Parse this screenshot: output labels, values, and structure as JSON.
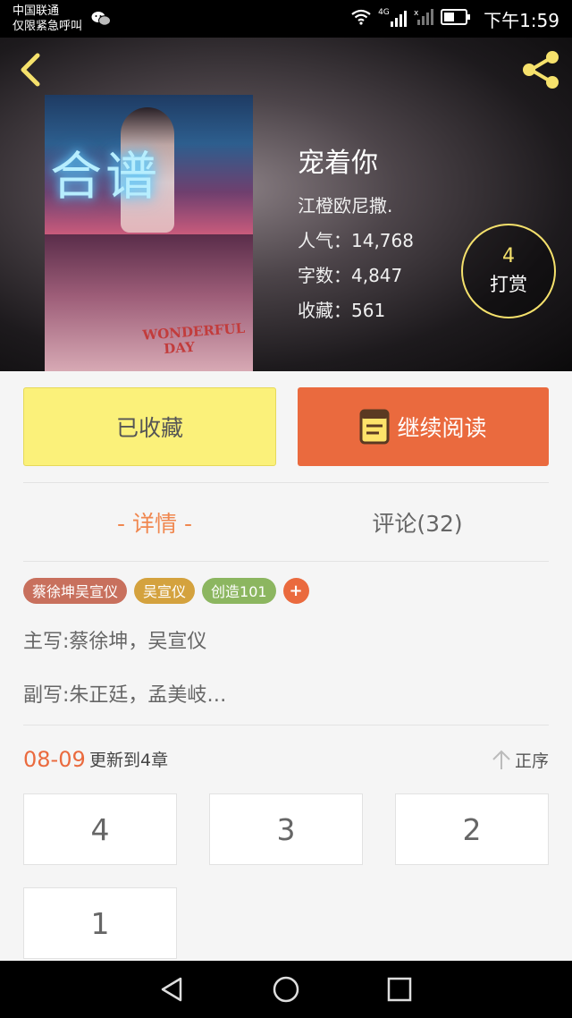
{
  "status_bar": {
    "carrier_line1": "中国联通",
    "carrier_line2": "仅限紧急呼叫",
    "network": "4G",
    "time": "下午1:59"
  },
  "icons": {
    "back": "back-icon",
    "share": "share-icon",
    "read": "book-icon",
    "sort": "arrow-up-icon"
  },
  "book": {
    "cover_neon_text": "合谱",
    "cover_shirt_text": "WONDERFUL DAY",
    "title": "宠着你",
    "author": "江橙欧尼撒.",
    "popularity": "人气：14,768",
    "word_count": "字数：4,847",
    "favorites": "收藏：561"
  },
  "reward": {
    "count": "4",
    "label": "打赏"
  },
  "actions": {
    "collected_label": "已收藏",
    "continue_label": "继续阅读"
  },
  "tabs": {
    "detail": "- 详情 -",
    "comments": "评论(32)"
  },
  "tags": [
    {
      "label": "蔡徐坤吴宣仪",
      "color": "#c8705d"
    },
    {
      "label": "吴宣仪",
      "color": "#d4a23e"
    },
    {
      "label": "创造101",
      "color": "#8cb660"
    }
  ],
  "tag_add_label": "+",
  "description": {
    "main_writer": "主写:蔡徐坤，吴宣仪",
    "sub_writer": "副写:朱正廷，孟美岐…"
  },
  "updates": {
    "date": "08-09",
    "text": "更新到4章",
    "sort_label": "正序"
  },
  "chapters": [
    "4",
    "3",
    "2",
    "1"
  ],
  "colors": {
    "accent": "#ea6a3e",
    "collected": "#fbf17a",
    "reward_ring": "#f5e16c",
    "tab_active": "#f0874f"
  }
}
